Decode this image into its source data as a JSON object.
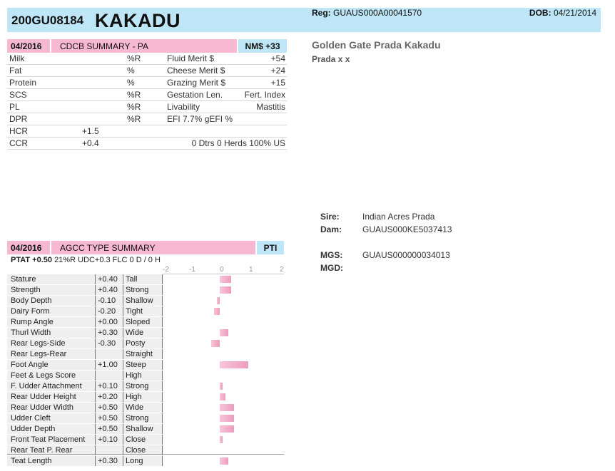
{
  "header": {
    "reg_id": "200GU08184",
    "name": "KAKADU",
    "reg_label": "Reg:",
    "reg_value": "GUAUS000A00041570",
    "dob_label": "DOB:",
    "dob_value": "04/21/2014"
  },
  "cdcb": {
    "date": "04/2016",
    "title": "CDCB SUMMARY - PA",
    "nm": "NM$ +33",
    "rows": [
      {
        "trait": "Milk",
        "val": "",
        "unit": "%R",
        "merit": "Fluid Merit $",
        "mval": "+54"
      },
      {
        "trait": "Fat",
        "val": "",
        "unit": "%",
        "merit": "Cheese Merit $",
        "mval": "+24"
      },
      {
        "trait": "Protein",
        "val": "",
        "unit": "%",
        "merit": "Grazing Merit $",
        "mval": "+15"
      },
      {
        "trait": "SCS",
        "val": "",
        "unit": "%R",
        "merit": "Gestation Len.",
        "mval": "Fert. Index"
      },
      {
        "trait": "PL",
        "val": "",
        "unit": "%R",
        "merit": "Livability",
        "mval": "Mastitis"
      },
      {
        "trait": "DPR",
        "val": "",
        "unit": "%R",
        "merit": "EFI  7.7%   gEFI  %",
        "mval": ""
      },
      {
        "trait": "HCR",
        "val": "+1.5",
        "unit": "",
        "merit": "",
        "mval": ""
      },
      {
        "trait": "CCR",
        "val": "+0.4",
        "unit": "",
        "merit": "",
        "mval": "0 Dtrs   0 Herds   100% US"
      }
    ]
  },
  "bull": {
    "full_name": "Golden Gate Prada Kakadu",
    "sub": "Prada x x"
  },
  "pedigree": {
    "sire_label": "Sire:",
    "sire_value": "Indian Acres Prada",
    "dam_label": "Dam:",
    "dam_value": "GUAUS000KE5037413",
    "mgs_label": "MGS:",
    "mgs_value": "GUAUS000000034013",
    "mgd_label": "MGD:",
    "mgd_value": ""
  },
  "agcc": {
    "date": "04/2016",
    "title": "AGCC TYPE SUMMARY",
    "pti": "PTI",
    "ptat_label": "PTAT",
    "ptat_value": "+0.50",
    "ptat_rest": "21%R   UDC+0.3   FLC     0 D /  0 H",
    "scale": [
      "-2",
      "-1",
      "0",
      "1",
      "2"
    ],
    "traits": [
      {
        "trait": "Stature",
        "val": "+0.40",
        "desc": "Tall",
        "score": 0.4
      },
      {
        "trait": "Strength",
        "val": "+0.40",
        "desc": "Strong",
        "score": 0.4
      },
      {
        "trait": "Body Depth",
        "val": "-0.10",
        "desc": "Shallow",
        "score": -0.1
      },
      {
        "trait": "Dairy Form",
        "val": "-0.20",
        "desc": "Tight",
        "score": -0.2
      },
      {
        "trait": "Rump Angle",
        "val": "+0.00",
        "desc": "Sloped",
        "score": 0.0
      },
      {
        "trait": "Thurl Width",
        "val": "+0.30",
        "desc": "Wide",
        "score": 0.3
      },
      {
        "trait": "Rear Legs-Side",
        "val": "-0.30",
        "desc": "Posty",
        "score": -0.3
      },
      {
        "trait": "Rear Legs-Rear",
        "val": "",
        "desc": "Straight",
        "score": null
      },
      {
        "trait": "Foot Angle",
        "val": "+1.00",
        "desc": "Steep",
        "score": 1.0
      },
      {
        "trait": "Feet & Legs Score",
        "val": "",
        "desc": "High",
        "score": null
      },
      {
        "trait": "F. Udder Attachment",
        "val": "+0.10",
        "desc": "Strong",
        "score": 0.1
      },
      {
        "trait": "Rear Udder Height",
        "val": "+0.20",
        "desc": "High",
        "score": 0.2
      },
      {
        "trait": "Rear Udder Width",
        "val": "+0.50",
        "desc": "Wide",
        "score": 0.5
      },
      {
        "trait": "Udder Cleft",
        "val": "+0.50",
        "desc": "Strong",
        "score": 0.5
      },
      {
        "trait": "Udder Depth",
        "val": "+0.50",
        "desc": "Shallow",
        "score": 0.5
      },
      {
        "trait": "Front Teat Placement",
        "val": "+0.10",
        "desc": "Close",
        "score": 0.1
      },
      {
        "trait": "Rear Teat P. Rear",
        "val": "",
        "desc": "Close",
        "score": null
      },
      {
        "trait": "Teat Length",
        "val": "+0.30",
        "desc": "Long",
        "score": 0.3
      }
    ]
  }
}
